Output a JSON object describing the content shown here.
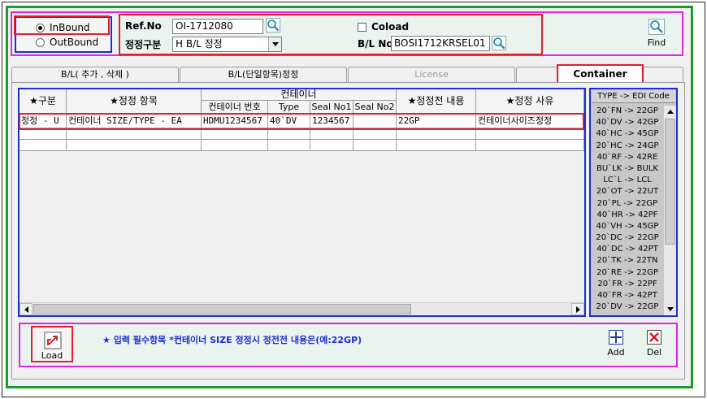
{
  "header": {
    "direction_options": [
      {
        "label": "InBound",
        "selected": true
      },
      {
        "label": "OutBound",
        "selected": false
      }
    ],
    "ref_no_label": "Ref.No",
    "ref_no_value": "OI-1712080",
    "correction_type_label": "정정구분",
    "correction_type_value": "H B/L 정정",
    "coload_label": "Coload",
    "bl_no_label": "B/L No",
    "bl_no_value": "BOSI1712KRSEL01",
    "find_label": "Find"
  },
  "tabs": [
    {
      "label": "B/L( 추가 , 삭제 )",
      "active": false
    },
    {
      "label": "B/L(단일항목)정정",
      "active": false
    },
    {
      "label": "License",
      "active": false,
      "disabled": true
    },
    {
      "label": "Container",
      "active": true
    }
  ],
  "grid": {
    "headers": {
      "category": "★구분",
      "item": "★정정 항목",
      "container_group": "컨테이너",
      "container_no": "컨테이너 번호",
      "type": "Type",
      "seal1": "Seal No1",
      "seal2": "Seal No2",
      "before": "★정정전 내용",
      "reason": "★정정 사유"
    },
    "rows": [
      {
        "category": "정정 - U",
        "item": "컨테이너 SIZE/TYPE - EA",
        "container_no": "HDMU1234567",
        "type": "40`DV",
        "seal1": "1234567",
        "seal2": "",
        "before": "22GP",
        "reason": "컨테이너사이즈정정"
      }
    ]
  },
  "edi_panel": {
    "title": "TYPE -> EDI Code",
    "items": [
      "20`FN -> 22GP",
      "40`DV -> 42GP",
      "40`HC -> 45GP",
      "20`HC -> 24GP",
      "40`RF -> 42RE",
      "BU`LK -> BULK",
      "LC`L -> LCL",
      "20`OT -> 22UT",
      "20`PL -> 22GP",
      "40`HR -> 42PF",
      "40`VH -> 45GP",
      "20`DC -> 22GP",
      "40`DC -> 42PT",
      "20`TK -> 22TN",
      "20`RE -> 22GP",
      "20`FR -> 22PF",
      "40`FR -> 42PT",
      "20`DV -> 22GP"
    ]
  },
  "footer": {
    "load_label": "Load",
    "notice": "★ 입력 필수항목  *컨테이너 SIZE 정정시 정전전 내용은(예:22GP)",
    "add_label": "Add",
    "del_label": "Del"
  },
  "colors": {
    "green_border": "#1c9a2c",
    "magenta_border": "#e025e0",
    "red_border": "#e01f2e",
    "blue_border": "#1a2fd6",
    "notice_text": "#1a2fd6"
  }
}
